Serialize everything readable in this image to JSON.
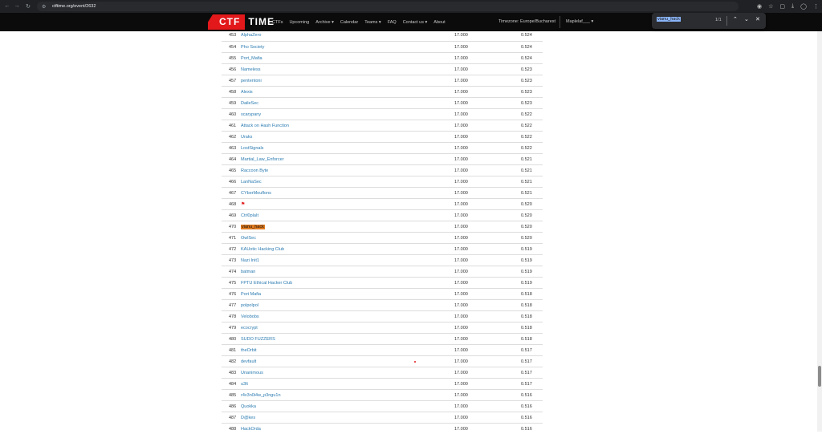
{
  "browser": {
    "url": "ctftime.org/event/2632",
    "back_icon": "arrow-left-icon",
    "forward_icon": "arrow-right-icon",
    "reload_icon": "reload-icon"
  },
  "site": {
    "logo_left": "CTF",
    "logo_right": "TIME",
    "nav": [
      "CTFs",
      "Upcoming",
      "Archive ▾",
      "Calendar",
      "Teams ▾",
      "FAQ",
      "Contact us ▾",
      "About"
    ],
    "timezone": "Timezone: Europe/Bucharest",
    "user": "Maplelaf___ ▾"
  },
  "findbar": {
    "query": "vianu_hack",
    "count": "1/1"
  },
  "rows": [
    {
      "rank": "453",
      "team": "AlphaZero",
      "points": "17.000",
      "rating": "0.524"
    },
    {
      "rank": "454",
      "team": "Pho Society",
      "points": "17.000",
      "rating": "0.524"
    },
    {
      "rank": "455",
      "team": "Port_Mafia",
      "points": "17.000",
      "rating": "0.524"
    },
    {
      "rank": "456",
      "team": "Nameless",
      "points": "17.000",
      "rating": "0.523"
    },
    {
      "rank": "457",
      "team": "pententoni",
      "points": "17.000",
      "rating": "0.523"
    },
    {
      "rank": "458",
      "team": "Alexis",
      "points": "17.000",
      "rating": "0.523"
    },
    {
      "rank": "459",
      "team": "DaileSec",
      "points": "17.000",
      "rating": "0.523"
    },
    {
      "rank": "460",
      "team": "scarypany",
      "points": "17.000",
      "rating": "0.522"
    },
    {
      "rank": "461",
      "team": "Attack on Hash Function",
      "points": "17.000",
      "rating": "0.522"
    },
    {
      "rank": "462",
      "team": "Uraks",
      "points": "17.000",
      "rating": "0.522"
    },
    {
      "rank": "463",
      "team": "LostSignals",
      "points": "17.000",
      "rating": "0.522"
    },
    {
      "rank": "464",
      "team": "Martial_Law_Enforcer",
      "points": "17.000",
      "rating": "0.521"
    },
    {
      "rank": "465",
      "team": "Raccoon Byte",
      "points": "17.000",
      "rating": "0.521"
    },
    {
      "rank": "466",
      "team": "LanNaSec",
      "points": "17.000",
      "rating": "0.521"
    },
    {
      "rank": "467",
      "team": "CYberMouflons",
      "points": "17.000",
      "rating": "0.521"
    },
    {
      "rank": "468",
      "team": "",
      "points": "17.000",
      "rating": "0.520",
      "flag": true
    },
    {
      "rank": "469",
      "team": "Ctrl0plaIt",
      "points": "17.000",
      "rating": "0.520"
    },
    {
      "rank": "470",
      "team": "vianu_hack",
      "points": "17.000",
      "rating": "0.520",
      "highlight": true
    },
    {
      "rank": "471",
      "team": "OwlSec",
      "points": "17.000",
      "rating": "0.520"
    },
    {
      "rank": "472",
      "team": "KAUotic Hacking Club",
      "points": "17.000",
      "rating": "0.519"
    },
    {
      "rank": "473",
      "team": "Nazi Init1",
      "points": "17.000",
      "rating": "0.519"
    },
    {
      "rank": "474",
      "team": "batman",
      "points": "17.000",
      "rating": "0.519"
    },
    {
      "rank": "475",
      "team": "FPTU Ethical Hacker Club",
      "points": "17.000",
      "rating": "0.519"
    },
    {
      "rank": "476",
      "team": "Port Mafia",
      "points": "17.000",
      "rating": "0.518"
    },
    {
      "rank": "477",
      "team": "polpolpol",
      "points": "17.000",
      "rating": "0.518"
    },
    {
      "rank": "478",
      "team": "Velobobs",
      "points": "17.000",
      "rating": "0.518"
    },
    {
      "rank": "479",
      "team": "ecocrypt",
      "points": "17.000",
      "rating": "0.518"
    },
    {
      "rank": "480",
      "team": "SUDO FUZZERS",
      "points": "17.000",
      "rating": "0.518"
    },
    {
      "rank": "481",
      "team": "theOrbit",
      "points": "17.000",
      "rating": "0.517"
    },
    {
      "rank": "482",
      "team": "devfault",
      "points": "17.000",
      "rating": "0.517"
    },
    {
      "rank": "483",
      "team": "Unanimous",
      "points": "17.000",
      "rating": "0.517"
    },
    {
      "rank": "484",
      "team": "u3lt",
      "points": "17.000",
      "rating": "0.517"
    },
    {
      "rank": "485",
      "team": "r4v3n0i4w_p3ngu1n",
      "points": "17.000",
      "rating": "0.516"
    },
    {
      "rank": "486",
      "team": "Quokka",
      "points": "17.000",
      "rating": "0.516"
    },
    {
      "rank": "487",
      "team": "D@kes",
      "points": "17.000",
      "rating": "0.516"
    },
    {
      "rank": "488",
      "team": "HackOrda",
      "points": "17.000",
      "rating": "0.516"
    }
  ]
}
